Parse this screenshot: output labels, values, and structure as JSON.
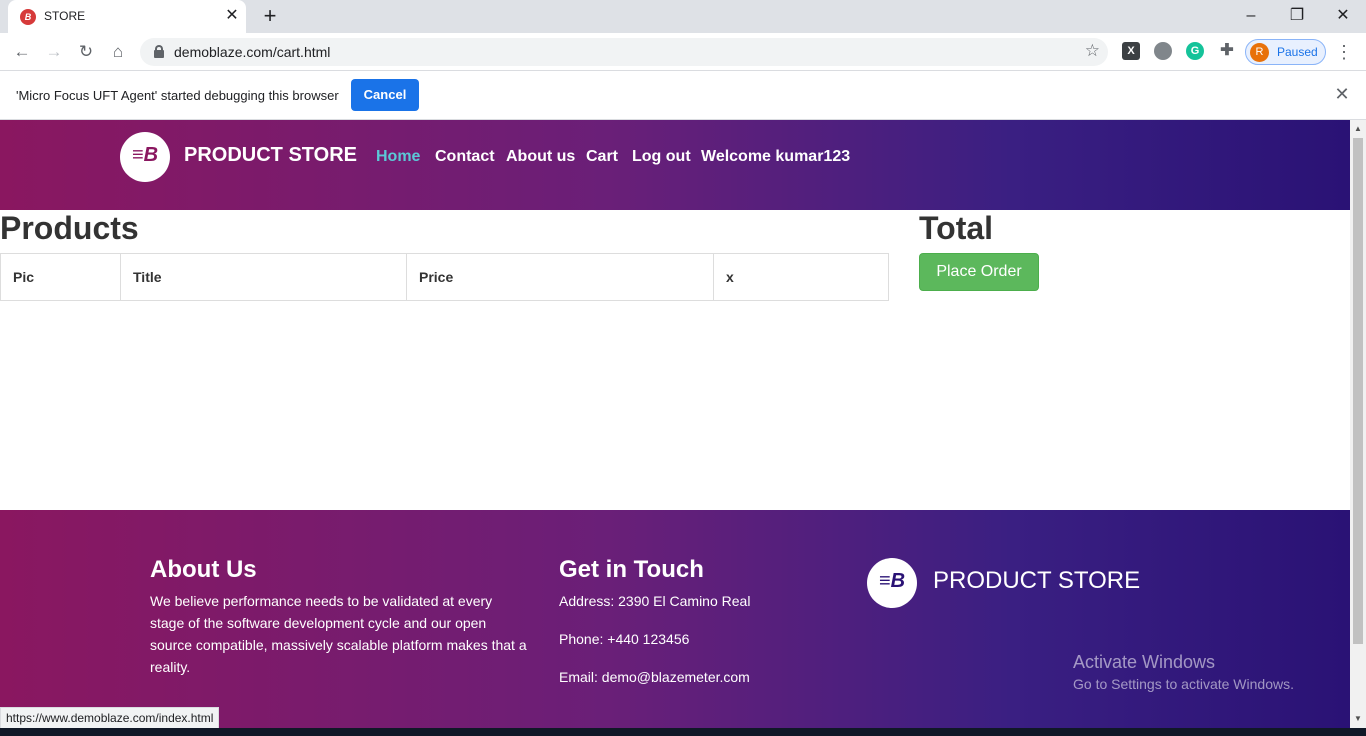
{
  "browser": {
    "tab_title": "STORE",
    "tab_favicon_text": "B",
    "new_tab_symbol": "+",
    "url": "demoblaze.com/cart.html",
    "profile_initial": "R",
    "profile_status": "Paused",
    "status_url": "https://www.demoblaze.com/index.html"
  },
  "infobar": {
    "message": "'Micro Focus UFT Agent' started debugging this browser",
    "cancel_label": "Cancel"
  },
  "navbar": {
    "brand": "PRODUCT STORE",
    "logo_glyph": "≡B",
    "links": [
      "Home",
      "Contact",
      "About us",
      "Cart",
      "Log out",
      "Welcome kumar123"
    ]
  },
  "cart": {
    "products_title": "Products",
    "total_title": "Total",
    "columns": [
      "Pic",
      "Title",
      "Price",
      "x"
    ],
    "place_order_label": "Place Order"
  },
  "footer": {
    "about_title": "About Us",
    "about_text": "We believe performance needs to be validated at every stage of the software development cycle and our open source compatible, massively scalable platform makes that a reality.",
    "contact_title": "Get in Touch",
    "address": "Address: 2390 El Camino Real",
    "phone": "Phone: +440 123456",
    "email": "Email: demo@blazemeter.com",
    "brand": "PRODUCT STORE"
  },
  "watermark": {
    "line1": "Activate Windows",
    "line2": "Go to Settings to activate Windows."
  },
  "colors": {
    "nav_gradient_start": "#8a1760",
    "nav_gradient_end": "#2a1275",
    "active_link": "#5bc8d6",
    "place_order": "#5cb85c",
    "cancel_button": "#1a73e8"
  }
}
